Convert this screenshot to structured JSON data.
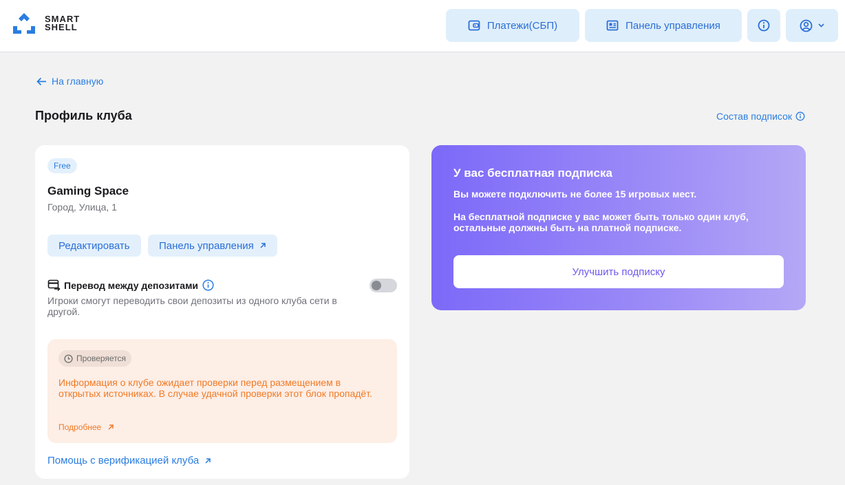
{
  "brand": {
    "line1": "SMART",
    "line2": "SHELL"
  },
  "header": {
    "payments_label": "Платежи(СБП)",
    "panel_label": "Панель управления"
  },
  "nav": {
    "back_label": "На главную"
  },
  "page": {
    "title": "Профиль клуба",
    "subscriptions_link": "Состав подписок"
  },
  "club": {
    "plan_badge": "Free",
    "name": "Gaming Space",
    "address": "Город, Улица, 1",
    "edit_label": "Редактировать",
    "panel_label": "Панель управления",
    "transfer_title": "Перевод между депозитами",
    "transfer_desc": "Игроки смогут переводить свои депозиты из одного клуба сети в другой.",
    "transfer_enabled": false,
    "status_badge": "Проверяется",
    "status_text": "Информация о клубе ожидает проверки перед размещением в открытых источниках. В случае удачной проверки этот блок пропадёт.",
    "status_more": "Подробнее",
    "verify_help": "Помощь с верификацией клуба"
  },
  "promo": {
    "title": "У вас бесплатная подписка",
    "line1": "Вы можете подключить не более 15 игровых мест.",
    "line2": "На бесплатной подписке у вас может быть только один клуб, остальные должны быть на платной подписке.",
    "upgrade_label": "Улучшить подписку"
  },
  "colors": {
    "accent": "#2a7de1",
    "button_bg": "#dfeefb",
    "warning": "#f07a25",
    "promo_gradient_start": "#7c69f8",
    "promo_gradient_end": "#b4a8f6"
  },
  "icons": {
    "logo": "smart-shell-logo-icon",
    "payments": "wallet-icon",
    "panel": "dashboard-icon",
    "info": "info-icon",
    "user": "user-circle-icon",
    "chevron": "chevron-down-icon",
    "back": "arrow-left-icon",
    "external": "arrow-up-right-icon",
    "transfer": "transfer-icon",
    "clock": "clock-icon"
  }
}
